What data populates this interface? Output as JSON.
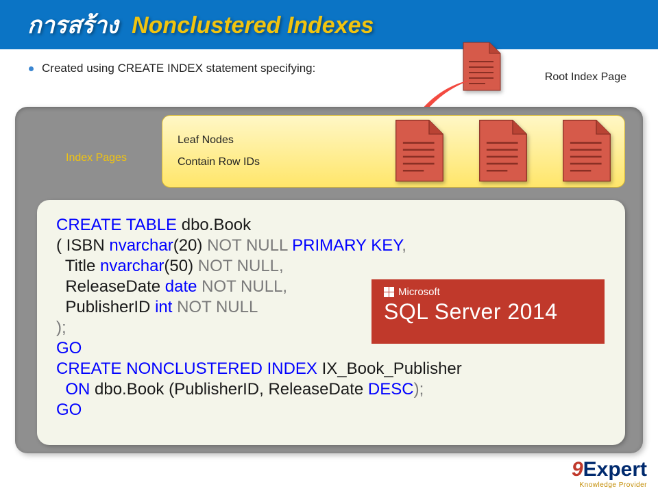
{
  "header": {
    "title_thai": "การสร้าง",
    "title_en": "Nonclustered  Indexes"
  },
  "bullet": "Created  using  CREATE  INDEX  statement  specifying:",
  "root_label": "Root  Index  Page",
  "index_pages_label": "Index  Pages",
  "leaf_box": {
    "line1": "Leaf  Nodes",
    "line2": "Contain  Row  IDs"
  },
  "code": {
    "l1_kw": "CREATE TABLE",
    "l1_rest": " dbo.Book",
    "l2_a": "( ISBN ",
    "l2_ty": "nvarchar",
    "l2_b": "(20) ",
    "l2_nn": "NOT NULL ",
    "l2_pk": "PRIMARY KEY",
    "l2_c": ",",
    "l3_a": "  Title ",
    "l3_ty": "nvarchar",
    "l3_b": "(50) ",
    "l3_nn": "NOT NULL",
    "l3_c": ",",
    "l4_a": "  ReleaseDate ",
    "l4_ty": "date ",
    "l4_nn": "NOT NULL",
    "l4_c": ",",
    "l5_a": "  PublisherID ",
    "l5_ty": "int ",
    "l5_nn": "NOT NULL",
    "l6": ");",
    "l7": "GO",
    "l8_kw": "CREATE NONCLUSTERED INDEX",
    "l8_rest": " IX_Book_Publisher",
    "l9_a": "  ",
    "l9_on": "ON",
    "l9_b": " dbo.Book (PublisherID, ReleaseDate ",
    "l9_desc": "DESC",
    "l9_c": ");",
    "l10": "GO"
  },
  "sql_badge": {
    "ms": "Microsoft",
    "product": "SQL Server 2014"
  },
  "brand": {
    "nine": "9",
    "name": "Expert",
    "tag": "Knowledge Provider"
  },
  "colors": {
    "header": "#0b74c5",
    "accent": "#f1c40f",
    "panel": "#8f8f8f",
    "badge": "#c0392b",
    "brand_blue": "#002a6e"
  }
}
